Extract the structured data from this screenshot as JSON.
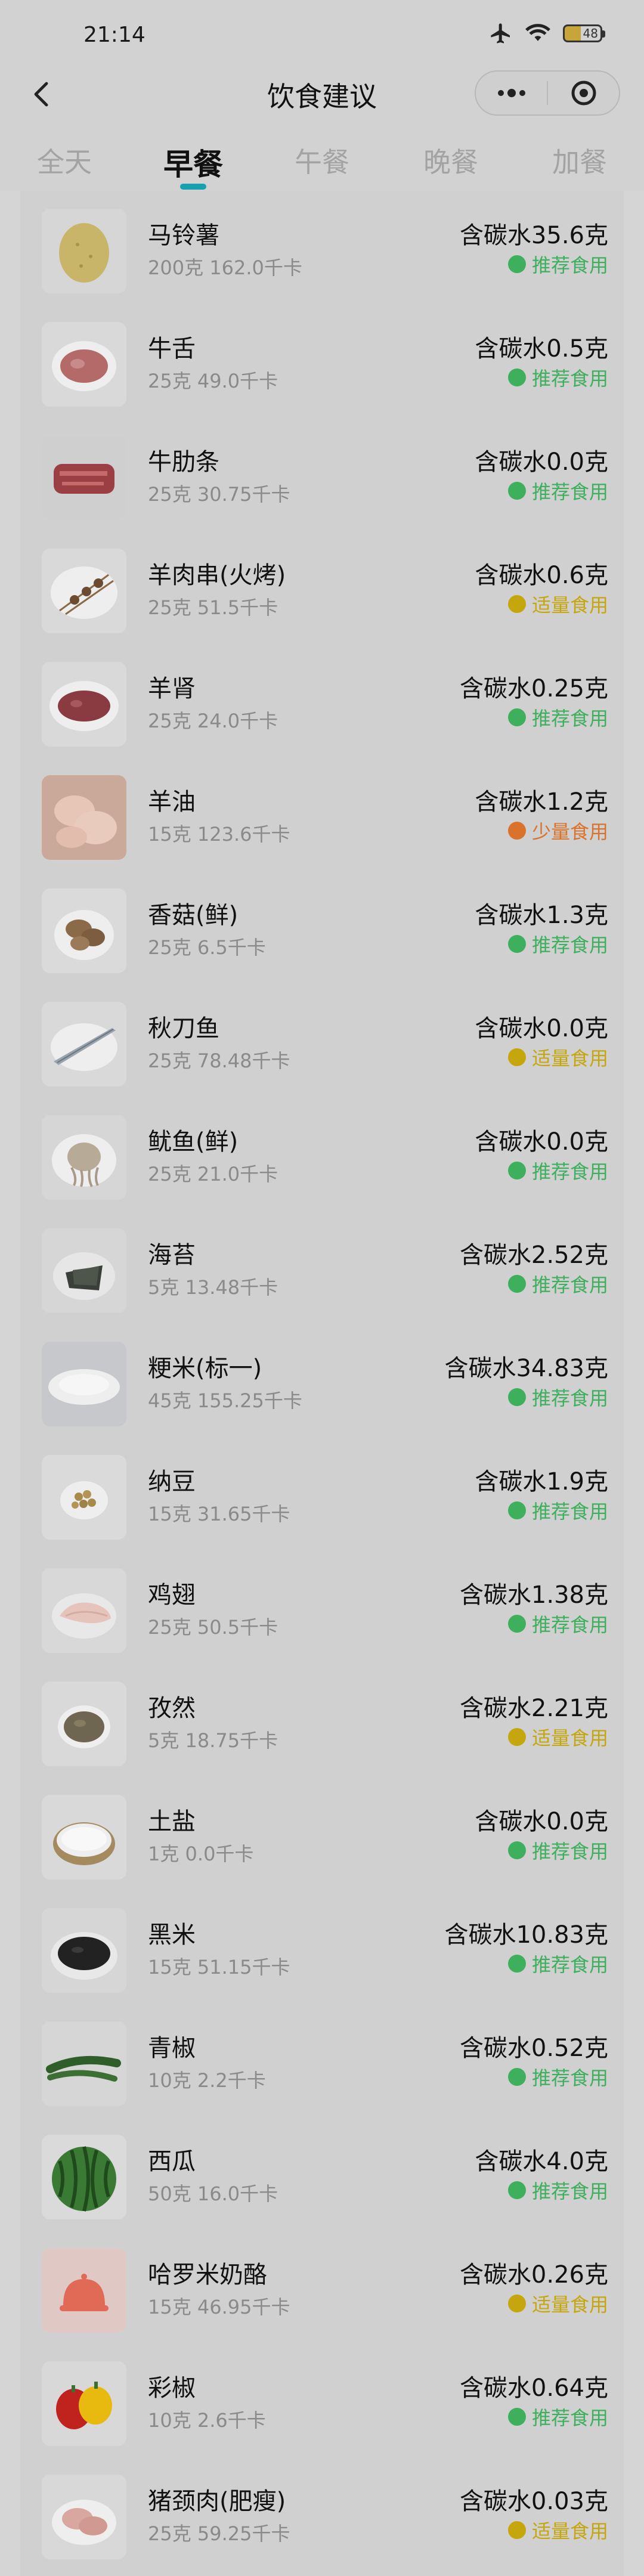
{
  "status_bar": {
    "time": "21:14",
    "battery": "48"
  },
  "header": {
    "title": "饮食建议"
  },
  "tabs": [
    {
      "label": "全天",
      "active": false
    },
    {
      "label": "早餐",
      "active": true
    },
    {
      "label": "午餐",
      "active": false
    },
    {
      "label": "晚餐",
      "active": false
    },
    {
      "label": "加餐",
      "active": false
    }
  ],
  "colors": {
    "recommend": "#3eaf5c",
    "moderate": "#c6a60d",
    "little": "#d9722b",
    "tab_indicator": "#18a0b0"
  },
  "foods": [
    {
      "name": "马铃薯",
      "portion": "200克 162.0千卡",
      "carb": "含碳水35.6克",
      "tag": "推荐食用",
      "level": "recommend",
      "icon": "potato-icon"
    },
    {
      "name": "牛舌",
      "portion": "25克 49.0千卡",
      "carb": "含碳水0.5克",
      "tag": "推荐食用",
      "level": "recommend",
      "icon": "beef-tongue-icon"
    },
    {
      "name": "牛肋条",
      "portion": "25克 30.75千卡",
      "carb": "含碳水0.0克",
      "tag": "推荐食用",
      "level": "recommend",
      "icon": "beef-rib-icon"
    },
    {
      "name": "羊肉串(火烤)",
      "portion": "25克 51.5千卡",
      "carb": "含碳水0.6克",
      "tag": "适量食用",
      "level": "moderate",
      "icon": "lamb-skewer-icon"
    },
    {
      "name": "羊肾",
      "portion": "25克 24.0千卡",
      "carb": "含碳水0.25克",
      "tag": "推荐食用",
      "level": "recommend",
      "icon": "lamb-kidney-icon"
    },
    {
      "name": "羊油",
      "portion": "15克 123.6千卡",
      "carb": "含碳水1.2克",
      "tag": "少量食用",
      "level": "little",
      "icon": "lamb-fat-icon"
    },
    {
      "name": "香菇(鲜)",
      "portion": "25克 6.5千卡",
      "carb": "含碳水1.3克",
      "tag": "推荐食用",
      "level": "recommend",
      "icon": "mushroom-icon"
    },
    {
      "name": "秋刀鱼",
      "portion": "25克 78.48千卡",
      "carb": "含碳水0.0克",
      "tag": "适量食用",
      "level": "moderate",
      "icon": "saury-icon"
    },
    {
      "name": "鱿鱼(鲜)",
      "portion": "25克 21.0千卡",
      "carb": "含碳水0.0克",
      "tag": "推荐食用",
      "level": "recommend",
      "icon": "squid-icon"
    },
    {
      "name": "海苔",
      "portion": "5克 13.48千卡",
      "carb": "含碳水2.52克",
      "tag": "推荐食用",
      "level": "recommend",
      "icon": "seaweed-icon"
    },
    {
      "name": "粳米(标一)",
      "portion": "45克 155.25千卡",
      "carb": "含碳水34.83克",
      "tag": "推荐食用",
      "level": "recommend",
      "icon": "rice-icon"
    },
    {
      "name": "纳豆",
      "portion": "15克 31.65千卡",
      "carb": "含碳水1.9克",
      "tag": "推荐食用",
      "level": "recommend",
      "icon": "natto-icon"
    },
    {
      "name": "鸡翅",
      "portion": "25克 50.5千卡",
      "carb": "含碳水1.38克",
      "tag": "推荐食用",
      "level": "recommend",
      "icon": "chicken-wing-icon"
    },
    {
      "name": "孜然",
      "portion": "5克 18.75千卡",
      "carb": "含碳水2.21克",
      "tag": "适量食用",
      "level": "moderate",
      "icon": "cumin-icon"
    },
    {
      "name": "土盐",
      "portion": "1克 0.0千卡",
      "carb": "含碳水0.0克",
      "tag": "推荐食用",
      "level": "recommend",
      "icon": "salt-icon"
    },
    {
      "name": "黑米",
      "portion": "15克 51.15千卡",
      "carb": "含碳水10.83克",
      "tag": "推荐食用",
      "level": "recommend",
      "icon": "black-rice-icon"
    },
    {
      "name": "青椒",
      "portion": "10克 2.2千卡",
      "carb": "含碳水0.52克",
      "tag": "推荐食用",
      "level": "recommend",
      "icon": "green-pepper-icon"
    },
    {
      "name": "西瓜",
      "portion": "50克 16.0千卡",
      "carb": "含碳水4.0克",
      "tag": "推荐食用",
      "level": "recommend",
      "icon": "watermelon-icon"
    },
    {
      "name": "哈罗米奶酪",
      "portion": "15克 46.95千卡",
      "carb": "含碳水0.26克",
      "tag": "适量食用",
      "level": "moderate",
      "icon": "cheese-placeholder-icon"
    },
    {
      "name": "彩椒",
      "portion": "10克 2.6千卡",
      "carb": "含碳水0.64克",
      "tag": "推荐食用",
      "level": "recommend",
      "icon": "bell-pepper-icon"
    },
    {
      "name": "猪颈肉(肥瘦)",
      "portion": "25克 59.25千卡",
      "carb": "含碳水0.03克",
      "tag": "适量食用",
      "level": "moderate",
      "icon": "pork-neck-icon"
    }
  ]
}
